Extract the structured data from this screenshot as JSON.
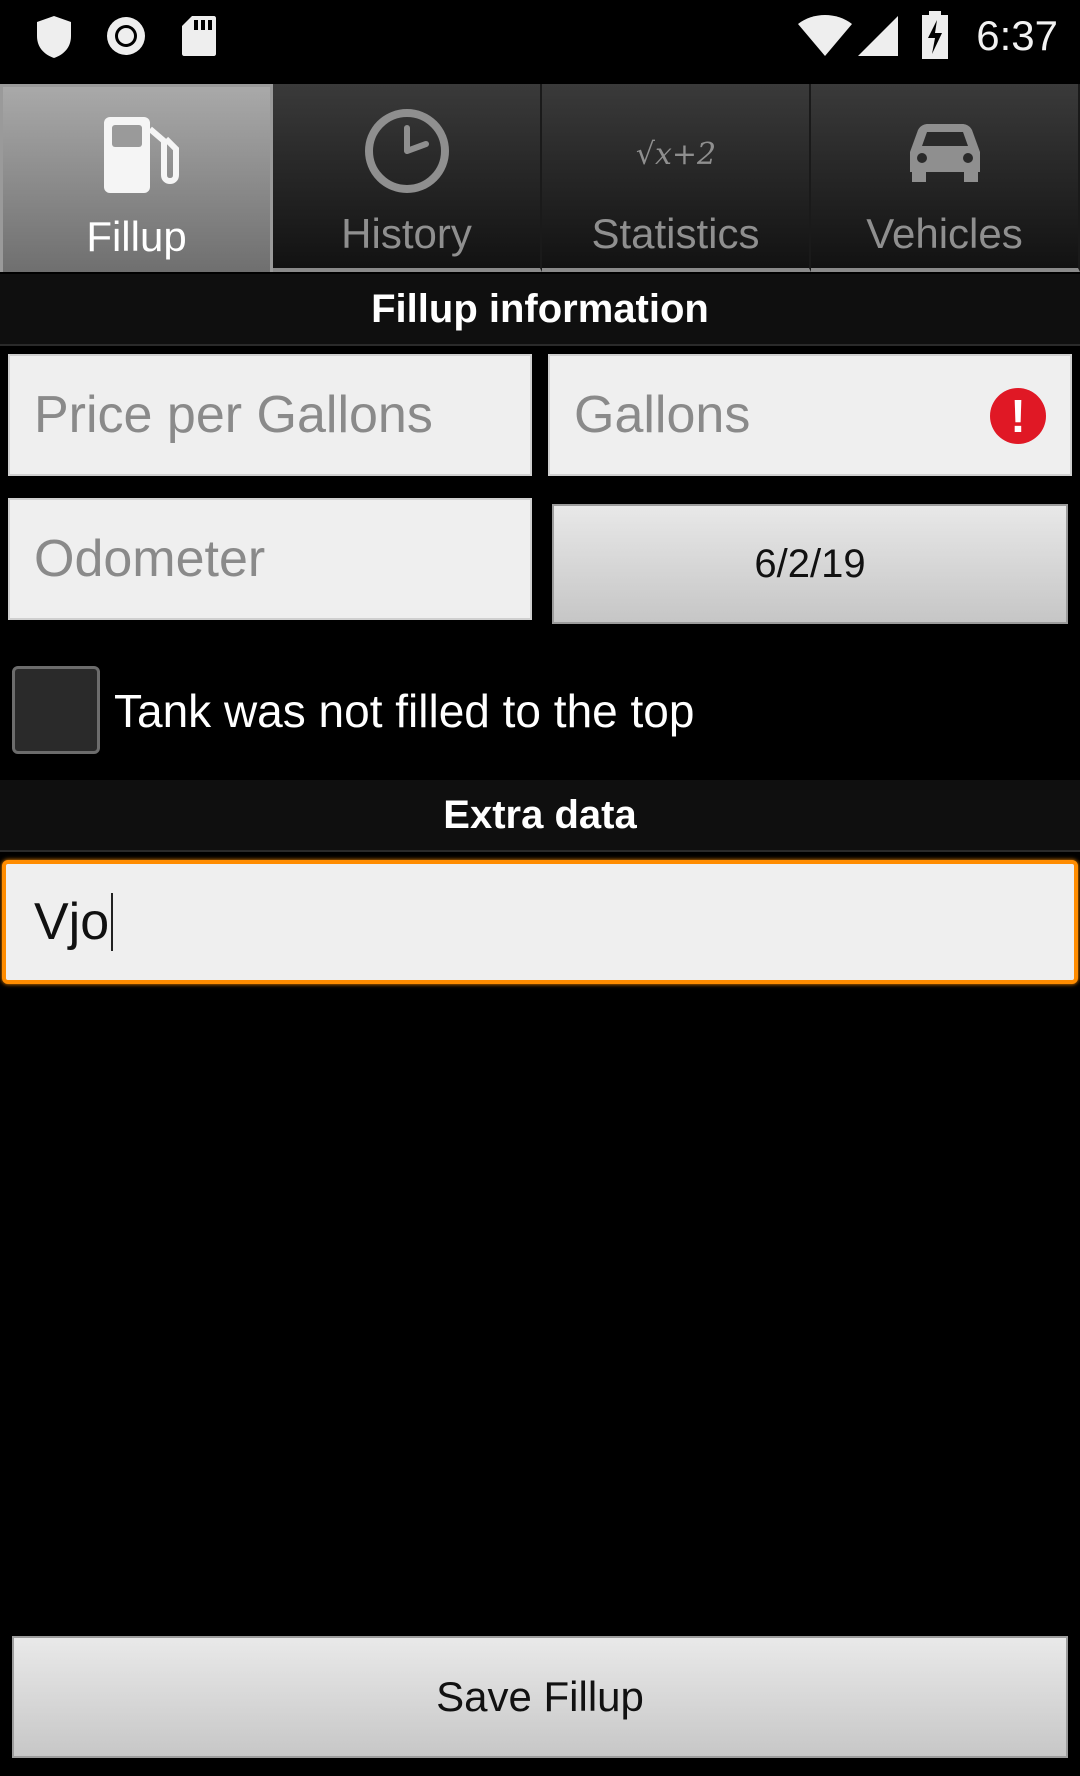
{
  "status_bar": {
    "time": "6:37"
  },
  "tabs": [
    {
      "label": "Fillup",
      "icon": "fuel-pump-icon",
      "active": true
    },
    {
      "label": "History",
      "icon": "clock-icon",
      "active": false
    },
    {
      "label": "Statistics",
      "icon": "math-formula-icon",
      "active": false
    },
    {
      "label": "Vehicles",
      "icon": "car-icon",
      "active": false
    }
  ],
  "fillup_section": {
    "title": "Fillup information",
    "price_placeholder": "Price per Gallons",
    "gallons_placeholder": "Gallons",
    "odometer_placeholder": "Odometer",
    "date_value": "6/2/19",
    "checkbox_label": "Tank was not filled to the top",
    "checkbox_checked": false
  },
  "extra_section": {
    "title": "Extra data",
    "value": "Vjo"
  },
  "save_button": {
    "label": "Save Fillup"
  },
  "colors": {
    "focus": "#ff8c00",
    "error": "#e01825",
    "active_tab": "#8a8a8a"
  }
}
